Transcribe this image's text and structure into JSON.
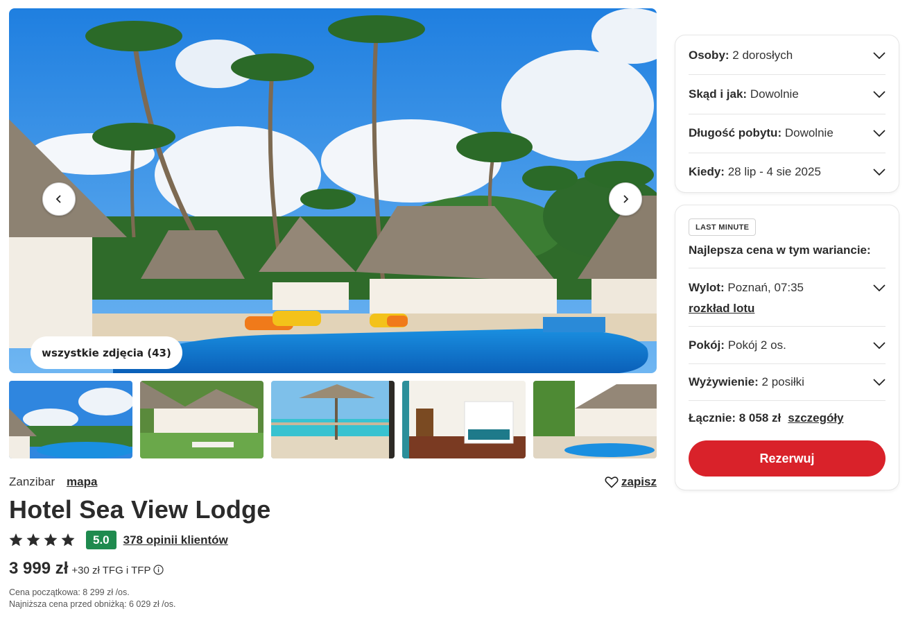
{
  "gallery": {
    "all_photos_label": "wszystkie zdjęcia (43)"
  },
  "hotel": {
    "region": "Zanzibar",
    "map_link": "mapa",
    "save_label": "zapisz",
    "name": "Hotel Sea View Lodge",
    "stars": 4,
    "score": "5.0",
    "reviews": "378 opinii klientów",
    "price": "3 999 zł",
    "price_extra": "+30 zł TFG i TFP",
    "initial_price": "Cena początkowa: 8 299 zł /os.",
    "lowest_price": "Najniższa cena przed obniżką: 6 029 zł /os."
  },
  "filters": [
    {
      "label": "Osoby:",
      "value": "2 dorosłych"
    },
    {
      "label": "Skąd i jak:",
      "value": "Dowolnie"
    },
    {
      "label": "Długość pobytu:",
      "value": "Dowolnie"
    },
    {
      "label": "Kiedy:",
      "value": "28 lip - 4 sie 2025"
    }
  ],
  "offer": {
    "badge": "LAST MINUTE",
    "title": "Najlepsza cena w tym wariancie:",
    "flight": {
      "label": "Wylot:",
      "value": "Poznań, 07:35"
    },
    "flight_link": "rozkład lotu",
    "room": {
      "label": "Pokój:",
      "value": "Pokój 2 os."
    },
    "meals": {
      "label": "Wyżywienie:",
      "value": "2 posiłki"
    },
    "total_label": "Łącznie: 8 058 zł",
    "details_link": "szczegóły",
    "book_button": "Rezerwuj"
  },
  "colors": {
    "accent_red": "#d9222a",
    "score_green": "#1f8a4e"
  }
}
